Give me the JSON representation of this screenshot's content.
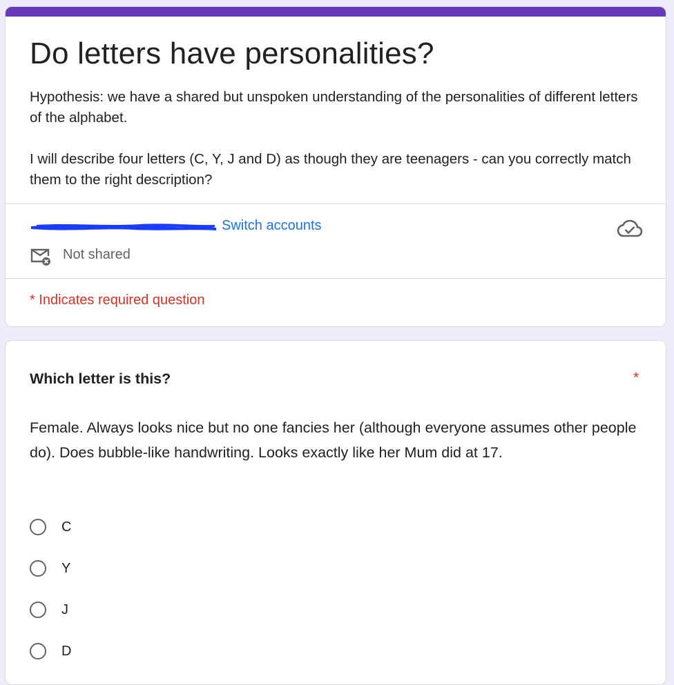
{
  "header": {
    "title": "Do letters have personalities?",
    "description_1": "Hypothesis: we have a shared but unspoken understanding of the personalities of different letters of the alphabet.",
    "description_2": "I will describe four letters (C, Y, J and D) as though they are teenagers - can you correctly match them to the right description?",
    "accent_color": "#673ab7"
  },
  "account": {
    "switch_label": "Switch accounts",
    "sharing_status": "Not shared",
    "save_icon": "cloud-check-icon",
    "mail_icon": "mail-off-icon",
    "redaction_color": "#1a3cff"
  },
  "required_note": "* Indicates required question",
  "question": {
    "title": "Which letter is this?",
    "required_marker": "*",
    "description": "Female. Always looks nice but no one fancies her (although everyone assumes other people do). Does bubble-like handwriting. Looks exactly like her Mum did at 17.",
    "options": [
      "C",
      "Y",
      "J",
      "D"
    ]
  },
  "colors": {
    "background": "#f0ebf8",
    "link": "#1a73e8",
    "required": "#d93025"
  }
}
